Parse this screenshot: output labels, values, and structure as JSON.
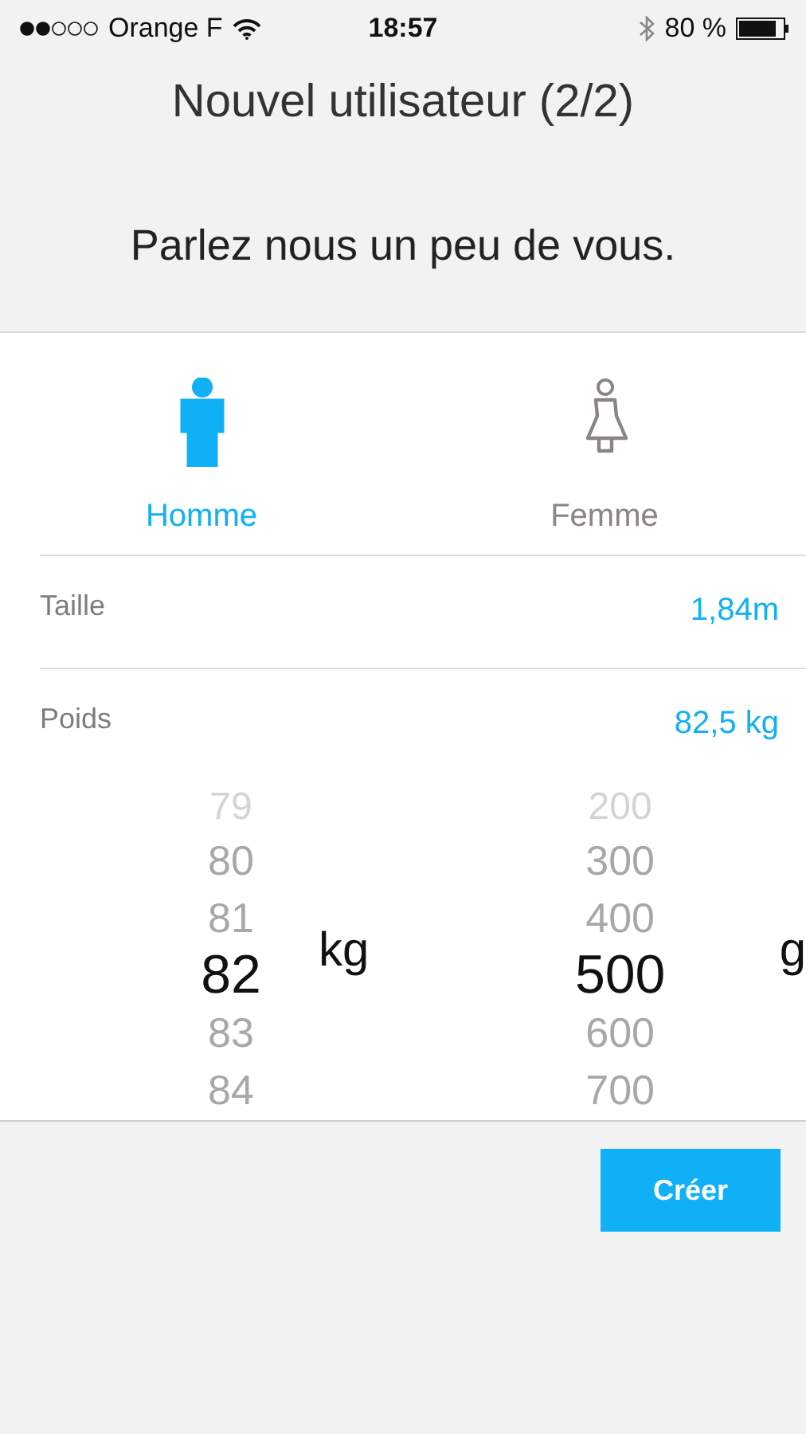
{
  "status_bar": {
    "carrier": "Orange F",
    "time": "18:57",
    "battery": "80 %"
  },
  "header": {
    "title": "Nouvel utilisateur (2/2)",
    "subtitle": "Parlez nous un peu de vous."
  },
  "genders": [
    {
      "kind": "male",
      "label": "Homme",
      "selected": true
    },
    {
      "kind": "female",
      "label": "Femme",
      "selected": false
    }
  ],
  "fields": [
    {
      "label": "Taille",
      "value": "1,84m"
    },
    {
      "label": "Poids",
      "value": "82,5 kg"
    }
  ],
  "picker": [
    {
      "unit": "kg",
      "items": [
        {
          "label": "79",
          "selected": false
        },
        {
          "label": "80",
          "selected": false
        },
        {
          "label": "81",
          "selected": false
        },
        {
          "label": "82",
          "selected": true
        },
        {
          "label": "83",
          "selected": false
        },
        {
          "label": "84",
          "selected": false
        }
      ]
    },
    {
      "unit": "g",
      "items": [
        {
          "label": "200",
          "selected": false
        },
        {
          "label": "300",
          "selected": false
        },
        {
          "label": "400",
          "selected": false
        },
        {
          "label": "500",
          "selected": true
        },
        {
          "label": "600",
          "selected": false
        },
        {
          "label": "700",
          "selected": false
        }
      ]
    }
  ],
  "create_button": "Créer"
}
